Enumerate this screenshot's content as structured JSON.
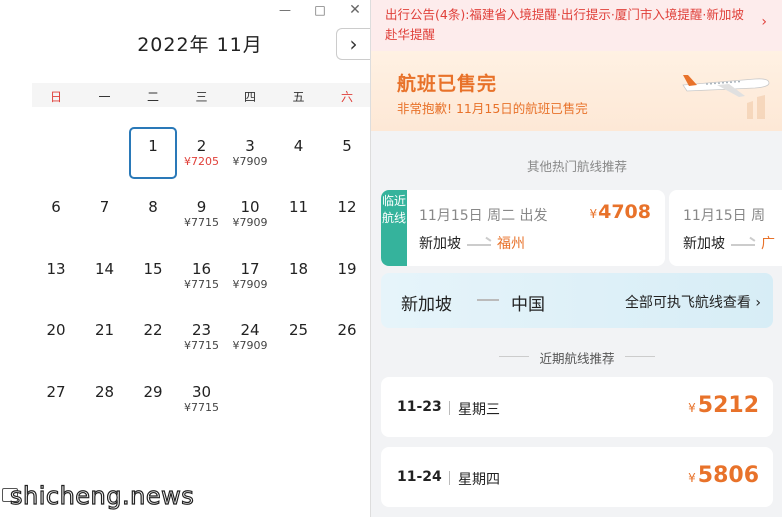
{
  "calendar": {
    "window_controls": {
      "minimize": "—",
      "maximize": "□",
      "close": "✕"
    },
    "month_title": "2022年 11月",
    "next_icon": "chevron-right-icon",
    "weekdays": [
      "日",
      "一",
      "二",
      "三",
      "四",
      "五",
      "六"
    ],
    "weekend_color": "#e0403a",
    "weeks": [
      [
        null,
        null,
        {
          "d": "1",
          "p": "",
          "selected": true
        },
        {
          "d": "2",
          "p": "¥7205",
          "red": true
        },
        {
          "d": "3",
          "p": "¥7909"
        },
        {
          "d": "4",
          "p": ""
        },
        {
          "d": "5",
          "p": ""
        }
      ],
      [
        {
          "d": "6",
          "p": ""
        },
        {
          "d": "7",
          "p": ""
        },
        {
          "d": "8",
          "p": ""
        },
        {
          "d": "9",
          "p": "¥7715"
        },
        {
          "d": "10",
          "p": "¥7909"
        },
        {
          "d": "11",
          "p": ""
        },
        {
          "d": "12",
          "p": ""
        }
      ],
      [
        {
          "d": "13",
          "p": ""
        },
        {
          "d": "14",
          "p": ""
        },
        {
          "d": "15",
          "p": ""
        },
        {
          "d": "16",
          "p": "¥7715"
        },
        {
          "d": "17",
          "p": "¥7909"
        },
        {
          "d": "18",
          "p": ""
        },
        {
          "d": "19",
          "p": ""
        }
      ],
      [
        {
          "d": "20",
          "p": ""
        },
        {
          "d": "21",
          "p": ""
        },
        {
          "d": "22",
          "p": ""
        },
        {
          "d": "23",
          "p": "¥7715"
        },
        {
          "d": "24",
          "p": "¥7909"
        },
        {
          "d": "25",
          "p": ""
        },
        {
          "d": "26",
          "p": ""
        }
      ],
      [
        {
          "d": "27",
          "p": ""
        },
        {
          "d": "28",
          "p": ""
        },
        {
          "d": "29",
          "p": ""
        },
        {
          "d": "30",
          "p": "¥7715"
        },
        null,
        null,
        null
      ]
    ]
  },
  "panel": {
    "notice": {
      "text": "出行公告(4条):福建省入境提醒·出行提示·厦门市入境提醒·新加坡赴华提醒",
      "arrow": "›",
      "color": "#e0403a"
    },
    "soldout": {
      "title": "航班已售完",
      "subtitle": "非常抱歉!  11月15日的航班已售完",
      "icon": "airplane-icon",
      "color": "#e8722a"
    },
    "recommend_title": "其他热门航线推荐",
    "cards": [
      {
        "tag": "临近航线",
        "date": "11月15日 周二 出发",
        "yen": "¥",
        "price": "4708",
        "from": "新加坡",
        "to": "福州"
      },
      {
        "date": "11月15日 周",
        "from": "新加坡",
        "to": "广"
      }
    ],
    "all_routes": {
      "from": "新加坡",
      "to": "中国",
      "link": "全部可执飞航线查看 ›"
    },
    "recent_title": "近期航线推荐",
    "recent": [
      {
        "date": "11-23",
        "week": "星期三",
        "yen": "¥",
        "price": "5212"
      },
      {
        "date": "11-24",
        "week": "星期四",
        "yen": "¥",
        "price": "5806"
      }
    ],
    "accent_color": "#e8722a",
    "tag_color": "#35b39c"
  },
  "watermark": "shicheng.news"
}
